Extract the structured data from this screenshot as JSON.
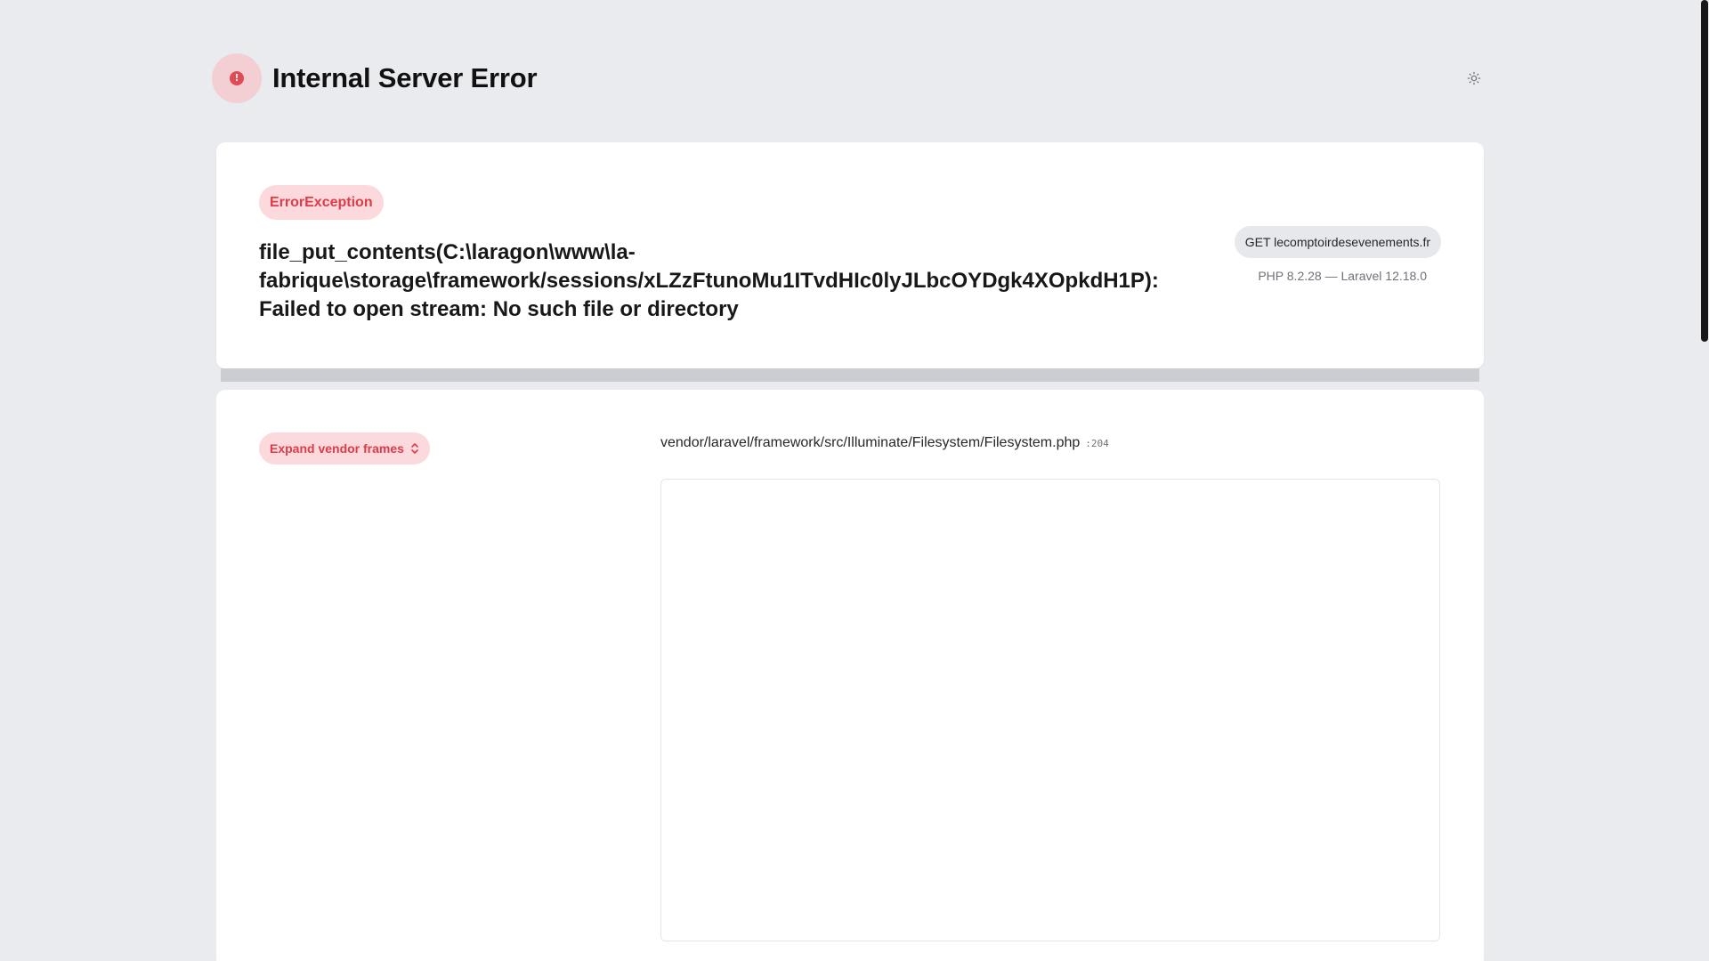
{
  "header": {
    "title": "Internal Server Error",
    "error_icon": "exclamation-circle-icon",
    "theme_icon": "sun-icon"
  },
  "exception": {
    "type": "ErrorException",
    "message": "file_put_contents(C:\\laragon\\www\\la-fabrique\\storage\\framework/sessions/xLZzFtunoMu1ITvdHIc0lyJLbcOYDgk4XOpkdH1P): Failed to open stream: No such file or directory",
    "request": "GET lecomptoirdesevenements.fr",
    "versions": "PHP 8.2.28 — Laravel 12.18.0"
  },
  "trace": {
    "expand_label": "Expand vendor frames",
    "expand_icon": "chevron-up-down-icon",
    "file": "vendor/laravel/framework/src/Illuminate/Filesystem/Filesystem.php",
    "line": ":204"
  },
  "colors": {
    "background": "#e9ebef",
    "accent_red": "#de3c47",
    "badge_red_bg": "#fbd9dc",
    "icon_circle_bg": "#f3cfd3"
  }
}
